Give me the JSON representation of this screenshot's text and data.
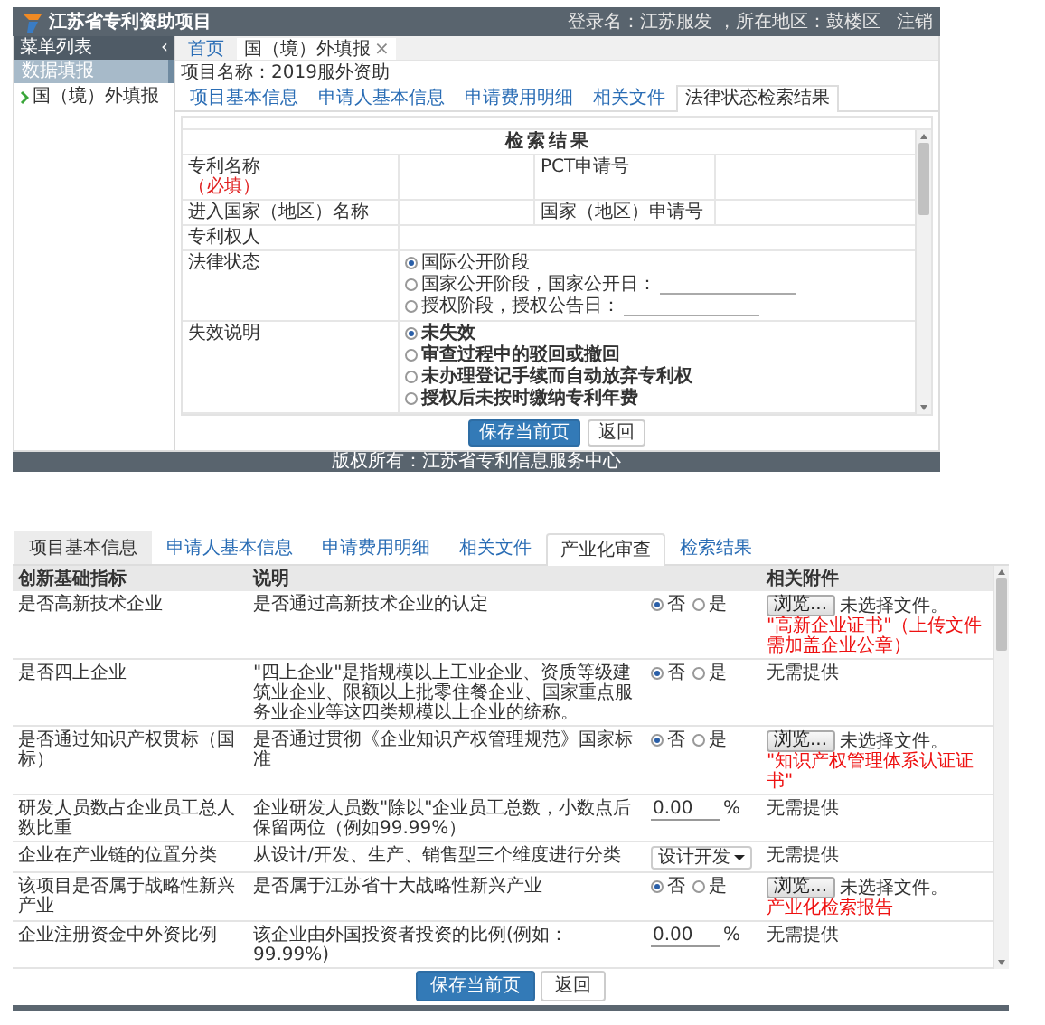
{
  "admin": {
    "logo": "江苏省专利资助项目",
    "user_info": "登录名：江苏服发 ，所在地区：鼓楼区",
    "logout": "注销",
    "sidebar": {
      "title": "菜单列表",
      "collapse": "‹",
      "items": [
        {
          "label": "数据填报",
          "kind": "group"
        },
        {
          "label": "国（境）外填报",
          "kind": "link"
        }
      ]
    },
    "page_tabs": [
      {
        "label": "首页",
        "selected": false
      },
      {
        "label": "国（境）外填报",
        "selected": true,
        "close": "×"
      }
    ],
    "project_name": "项目名称：2019服外资助",
    "tabs": [
      {
        "label": "项目基本信息",
        "selected": false
      },
      {
        "label": "申请人基本信息",
        "selected": false
      },
      {
        "label": "申请费用明细",
        "selected": false
      },
      {
        "label": "相关文件",
        "selected": false
      },
      {
        "label": "法律状态检索结果",
        "selected": true
      }
    ],
    "result": {
      "title": "检索结果",
      "rows": [
        {
          "kind": "pair",
          "label": "专利名称",
          "note": "（必填）",
          "label2": "PCT申请号"
        },
        {
          "kind": "pair",
          "label": "进入国家（地区）名称",
          "label2": "国家（地区）申请号"
        },
        {
          "kind": "text",
          "label": "专利权人"
        },
        {
          "kind": "radio",
          "label": "法律状态",
          "emphasis": false,
          "options": [
            {
              "label": "国际公开阶段",
              "selected": true,
              "field": false
            },
            {
              "label": "国家公开阶段，国家公开日：",
              "selected": false,
              "field": true
            },
            {
              "label": "授权阶段，授权公告日：",
              "selected": false,
              "field": true
            }
          ]
        },
        {
          "kind": "radio",
          "label": "失效说明",
          "emphasis": true,
          "options": [
            {
              "label": "未失效",
              "selected": true,
              "field": false
            },
            {
              "label": "审查过程中的驳回或撤回",
              "selected": false,
              "field": false
            },
            {
              "label": "未办理登记手续而自动放弃专利权",
              "selected": false,
              "field": false
            },
            {
              "label": "授权后未按时缴纳专利年费",
              "selected": false,
              "field": false
            }
          ]
        }
      ]
    },
    "buttons": [
      {
        "label": "保存当前页",
        "kind": "primary"
      },
      {
        "label": "返回",
        "kind": "default"
      }
    ],
    "footer": "版权所有：江苏省专利信息服务中心"
  },
  "review": {
    "tabs": [
      {
        "label": "项目基本信息",
        "selected": false,
        "hovered": true
      },
      {
        "label": "申请人基本信息",
        "selected": false,
        "hovered": false
      },
      {
        "label": "申请费用明细",
        "selected": false,
        "hovered": false
      },
      {
        "label": "相关文件",
        "selected": false,
        "hovered": false
      },
      {
        "label": "产业化审查",
        "selected": true,
        "hovered": false
      },
      {
        "label": "检索结果",
        "selected": false,
        "hovered": false
      }
    ],
    "columns": [
      "创新基础指标",
      "说明",
      "相关附件"
    ],
    "rows": [
      {
        "indicator": "是否高新技术企业",
        "description": "是否通过高新技术企业的认定",
        "kind": "radio",
        "options": [
          {
            "label": "否",
            "selected": true
          },
          {
            "label": "是",
            "selected": false
          }
        ],
        "attachment": {
          "kind": "upload",
          "button": "浏览...",
          "status": "未选择文件。",
          "note": "\"高新企业证书\"（上传文件需加盖企业公章）"
        }
      },
      {
        "indicator": "是否四上企业",
        "description": "\"四上企业\"是指规模以上工业企业、资质等级建筑业企业、限额以上批零住餐企业、国家重点服务业企业等这四类规模以上企业的统称。",
        "kind": "radio",
        "options": [
          {
            "label": "否",
            "selected": true
          },
          {
            "label": "是",
            "selected": false
          }
        ],
        "attachment": {
          "kind": "text",
          "text": "无需提供"
        }
      },
      {
        "indicator": "是否通过知识产权贯标（国标）",
        "description": "是否通过贯彻《企业知识产权管理规范》国家标准",
        "kind": "radio",
        "options": [
          {
            "label": "否",
            "selected": true
          },
          {
            "label": "是",
            "selected": false
          }
        ],
        "attachment": {
          "kind": "upload",
          "button": "浏览...",
          "status": "未选择文件。",
          "note": "\"知识产权管理体系认证证书\""
        }
      },
      {
        "indicator": "研发人员数占企业员工总人数比重",
        "description": "企业研发人员数\"除以\"企业员工总数，小数点后保留两位（例如99.99%）",
        "kind": "percent",
        "value": "0.00",
        "unit": "%",
        "attachment": {
          "kind": "text",
          "text": "无需提供"
        }
      },
      {
        "indicator": "企业在产业链的位置分类",
        "description": "从设计/开发、生产、销售型三个维度进行分类",
        "kind": "select",
        "value": "设计开发",
        "attachment": {
          "kind": "text",
          "text": "无需提供"
        }
      },
      {
        "indicator": "该项目是否属于战略性新兴产业",
        "description": "是否属于江苏省十大战略性新兴产业",
        "kind": "radio",
        "options": [
          {
            "label": "否",
            "selected": true
          },
          {
            "label": "是",
            "selected": false
          }
        ],
        "attachment": {
          "kind": "upload",
          "button": "浏览...",
          "status": "未选择文件。",
          "note": "产业化检索报告"
        }
      },
      {
        "indicator": "企业注册资金中外资比例",
        "description": "该企业由外国投资者投资的比例(例如：99.99%)",
        "kind": "percent",
        "value": "0.00",
        "unit": "%",
        "attachment": {
          "kind": "text",
          "text": "无需提供"
        }
      }
    ],
    "buttons": [
      {
        "label": "保存当前页",
        "kind": "primary"
      },
      {
        "label": "返回",
        "kind": "default"
      }
    ]
  }
}
